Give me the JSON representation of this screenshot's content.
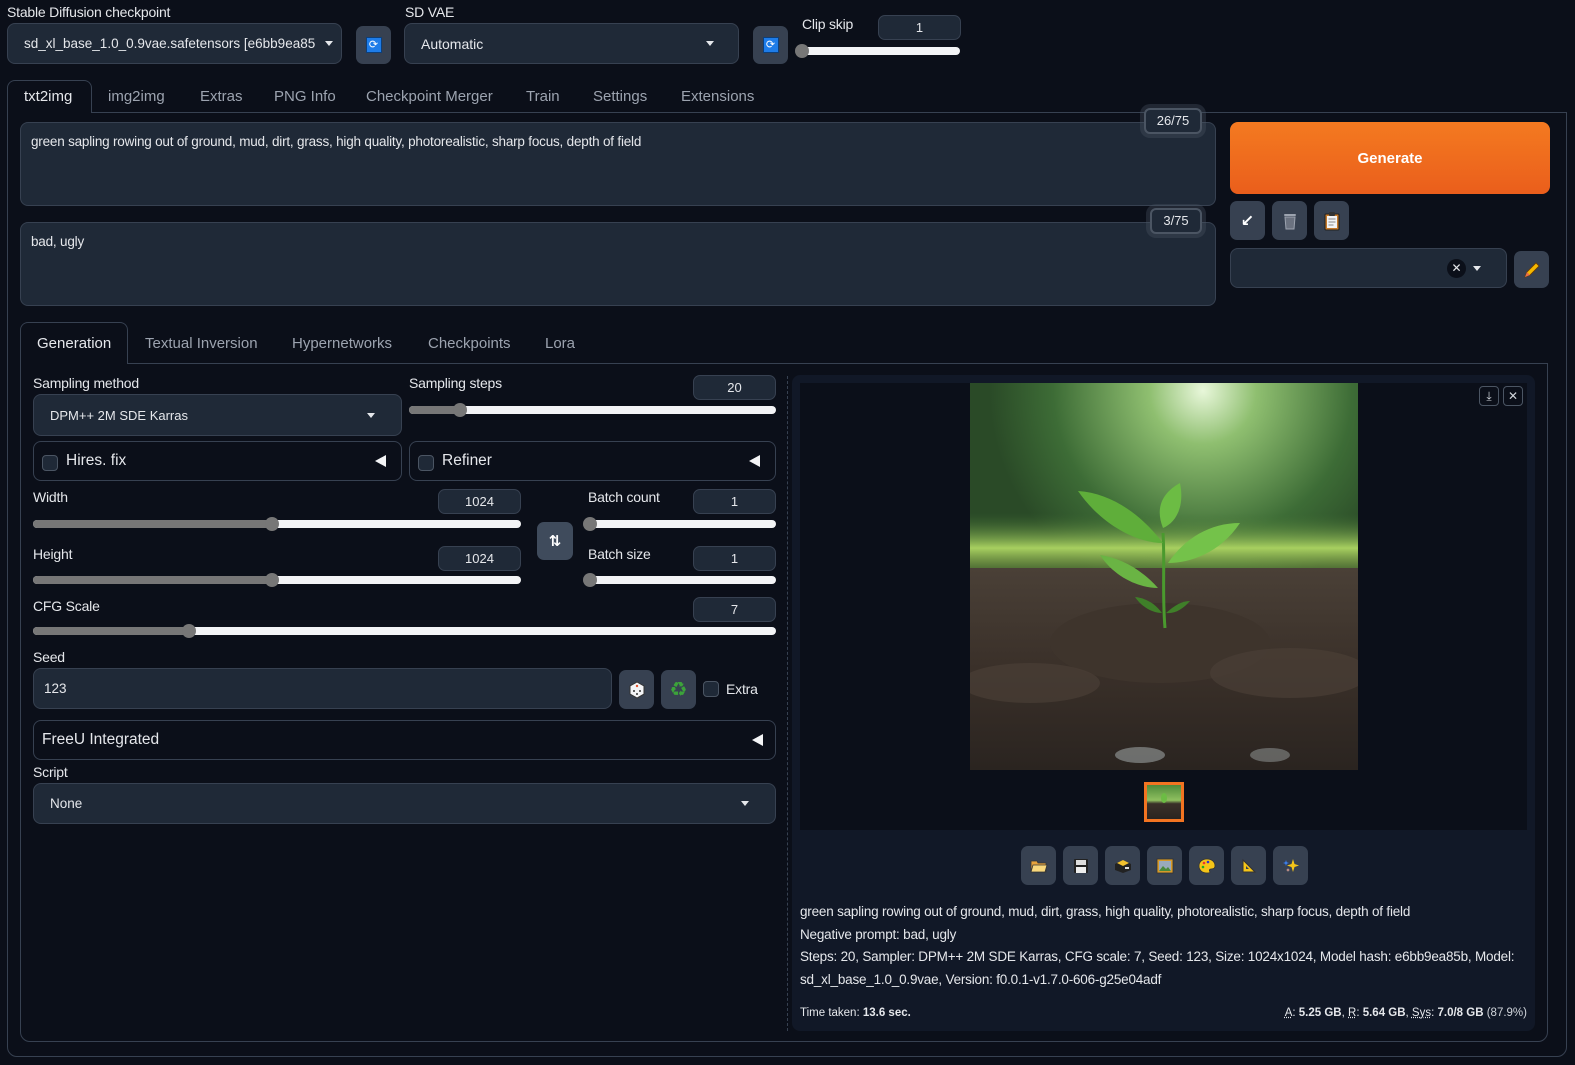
{
  "top": {
    "checkpoint": {
      "label": "Stable Diffusion checkpoint",
      "value": "sd_xl_base_1.0_0.9vae.safetensors [e6bb9ea85"
    },
    "vae": {
      "label": "SD VAE",
      "value": "Automatic"
    },
    "clip_skip": {
      "label": "Clip skip",
      "value": "1",
      "min": 1,
      "max": 12,
      "fraction": 0.0
    },
    "refresh_icon": "refresh-icon"
  },
  "main_tabs": [
    {
      "label": "txt2img",
      "active": true
    },
    {
      "label": "img2img"
    },
    {
      "label": "Extras"
    },
    {
      "label": "PNG Info"
    },
    {
      "label": "Checkpoint Merger"
    },
    {
      "label": "Train"
    },
    {
      "label": "Settings"
    },
    {
      "label": "Extensions"
    }
  ],
  "prompt": {
    "positive": "green sapling rowing out of ground, mud, dirt, grass, high quality, photorealistic, sharp focus, depth of field",
    "positive_count": "26/75",
    "negative": "bad, ugly",
    "negative_count": "3/75"
  },
  "actions": {
    "generate_label": "Generate",
    "generate_color": "#f26f21",
    "tool_icons": [
      "arrow-down-left-icon",
      "trash-icon",
      "clipboard-icon"
    ],
    "styles_value": "",
    "edit_icon": "pencil-icon"
  },
  "sub_tabs": [
    {
      "label": "Generation",
      "active": true
    },
    {
      "label": "Textual Inversion"
    },
    {
      "label": "Hypernetworks"
    },
    {
      "label": "Checkpoints"
    },
    {
      "label": "Lora"
    }
  ],
  "generation": {
    "sampling_method": {
      "label": "Sampling method",
      "value": "DPM++ 2M SDE Karras"
    },
    "sampling_steps": {
      "label": "Sampling steps",
      "value": "20",
      "fraction": 0.14
    },
    "hires_fix": {
      "label": "Hires. fix",
      "checked": false
    },
    "refiner": {
      "label": "Refiner",
      "checked": false
    },
    "width": {
      "label": "Width",
      "value": "1024",
      "fraction": 0.49
    },
    "height": {
      "label": "Height",
      "value": "1024",
      "fraction": 0.49
    },
    "batch_count": {
      "label": "Batch count",
      "value": "1",
      "fraction": 0.0
    },
    "batch_size": {
      "label": "Batch size",
      "value": "1",
      "fraction": 0.0
    },
    "cfg_scale": {
      "label": "CFG Scale",
      "value": "7",
      "fraction": 0.21
    },
    "seed": {
      "label": "Seed",
      "value": "123"
    },
    "extra": {
      "label": "Extra",
      "checked": false
    },
    "freeu": {
      "label": "FreeU Integrated"
    },
    "script": {
      "label": "Script",
      "value": "None"
    }
  },
  "output": {
    "image_alt": "green sapling growing out of soil",
    "toolbar_icons": [
      "folder-icon",
      "save-icon",
      "zip-icon",
      "send-to-img2img-icon",
      "send-to-inpaint-icon",
      "send-to-extras-icon",
      "sparkle-icon"
    ],
    "info": {
      "prompt": "green sapling rowing out of ground, mud, dirt, grass, high quality, photorealistic, sharp focus, depth of field",
      "negative": "Negative prompt: bad, ugly",
      "params_line1": "Steps: 20, Sampler: DPM++ 2M SDE Karras, CFG scale: 7, Seed: 123, Size: 1024x1024, Model hash: e6bb9ea85b, Model:",
      "params_line2": "sd_xl_base_1.0_0.9vae, Version: f0.0.1-v1.7.0-606-g25e04adf"
    },
    "time_label": "Time taken:",
    "time_value": "13.6 sec.",
    "mem": {
      "a_label": "A",
      "a_value": "5.25 GB",
      "r_label": "R",
      "r_value": "5.64 GB",
      "sys_label": "Sys",
      "sys_value": "7.0/8 GB",
      "sys_pct": "(87.9%)"
    }
  }
}
